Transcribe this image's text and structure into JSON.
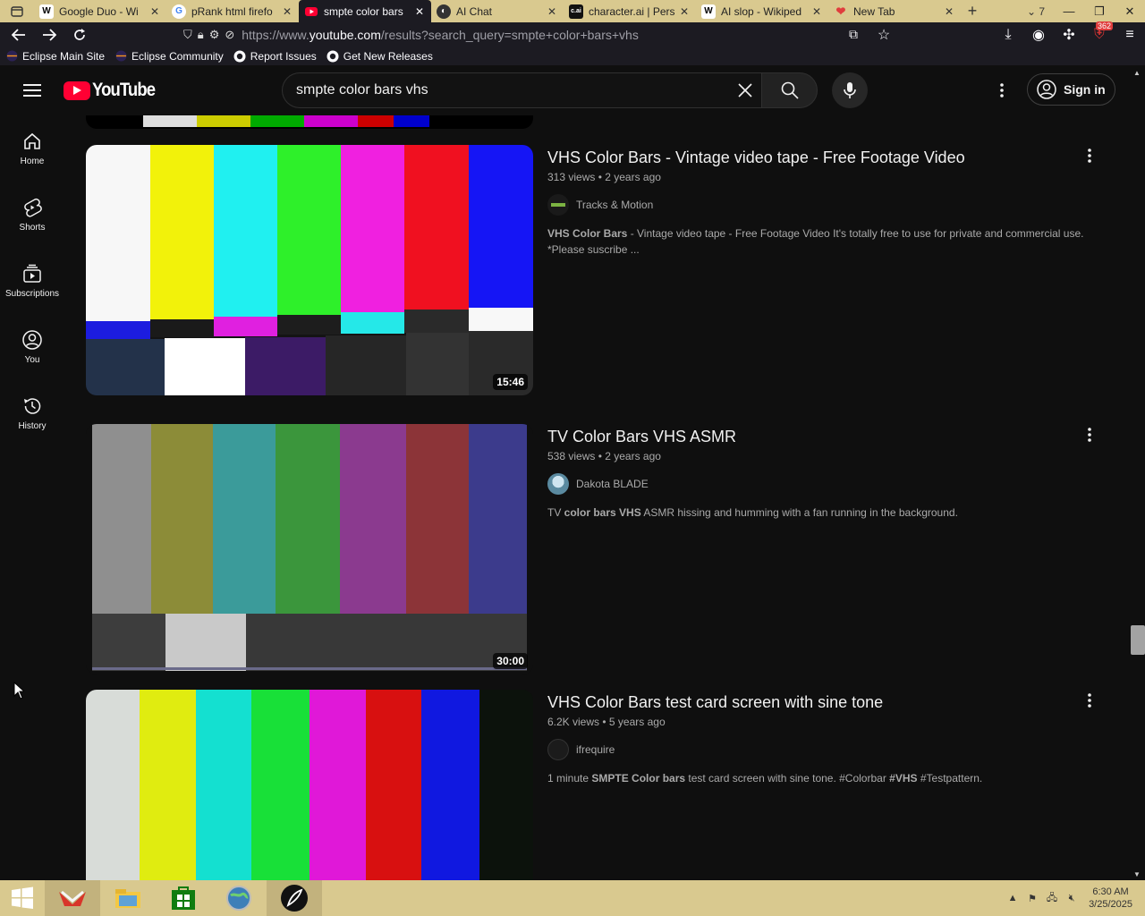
{
  "browser": {
    "tabs": [
      {
        "title": "Google Duo - Wi",
        "icon": "wikipedia-icon",
        "active": false
      },
      {
        "title": "pRank html firefo",
        "icon": "google-icon",
        "active": false
      },
      {
        "title": "smpte color bars",
        "icon": "youtube-icon",
        "active": true
      },
      {
        "title": "AI Chat",
        "icon": "ai-chat-icon",
        "active": false
      },
      {
        "title": "character.ai | Pers",
        "icon": "character-ai-icon",
        "active": false
      },
      {
        "title": "AI slop - Wikiped",
        "icon": "wikipedia-icon",
        "active": false
      },
      {
        "title": "New Tab",
        "icon": "new-tab-icon",
        "active": false
      }
    ],
    "tab_count": "7",
    "url_prefix": "https://www.",
    "url_domain": "youtube.com",
    "url_path": "/results?search_query=smpte+color+bars+vhs",
    "extension_badge": "362",
    "bookmarks": [
      {
        "label": "Eclipse Main Site",
        "icon": "eclipse-icon"
      },
      {
        "label": "Eclipse Community",
        "icon": "eclipse-icon"
      },
      {
        "label": "Report Issues",
        "icon": "github-icon"
      },
      {
        "label": "Get New Releases",
        "icon": "github-icon"
      }
    ]
  },
  "youtube": {
    "logo_text": "YouTube",
    "search_query": "smpte color bars vhs",
    "sign_in": "Sign in",
    "guide": [
      {
        "label": "Home",
        "icon": "home-icon"
      },
      {
        "label": "Shorts",
        "icon": "shorts-icon"
      },
      {
        "label": "Subscriptions",
        "icon": "subscriptions-icon"
      },
      {
        "label": "You",
        "icon": "you-icon"
      },
      {
        "label": "History",
        "icon": "history-icon"
      }
    ],
    "results": [
      {
        "title": "VHS Color Bars - Vintage video tape - Free Footage Video",
        "views": "313 views",
        "age": "2 years ago",
        "channel": "Tracks & Motion",
        "duration": "15:46",
        "desc_bold": "VHS Color Bars",
        "desc_rest": " - Vintage video tape - Free Footage Video It's totally free to use for private and commercial use. *Please suscribe ..."
      },
      {
        "title": "TV Color Bars VHS ASMR",
        "views": "538 views",
        "age": "2 years ago",
        "channel": "Dakota BLADE",
        "duration": "30:00",
        "desc_a": "TV ",
        "desc_b": "color bars VHS",
        "desc_c": " ASMR hissing and humming with a fan running in the background."
      },
      {
        "title": "VHS Color Bars test card screen with sine tone",
        "views": "6.2K views",
        "age": "5 years ago",
        "channel": "ifrequire",
        "desc_a": "1 minute ",
        "desc_b": "SMPTE Color bars",
        "desc_c": " test card screen with sine tone. #Colorbar ",
        "desc_d": "#VHS",
        "desc_e": " #Testpattern."
      }
    ]
  },
  "taskbar": {
    "time": "6:30 AM",
    "date": "3/25/2025"
  },
  "colors": {
    "accent_red": "#ff0033",
    "page_bg": "#0f0f0f",
    "taskbar": "#d9c98f"
  }
}
